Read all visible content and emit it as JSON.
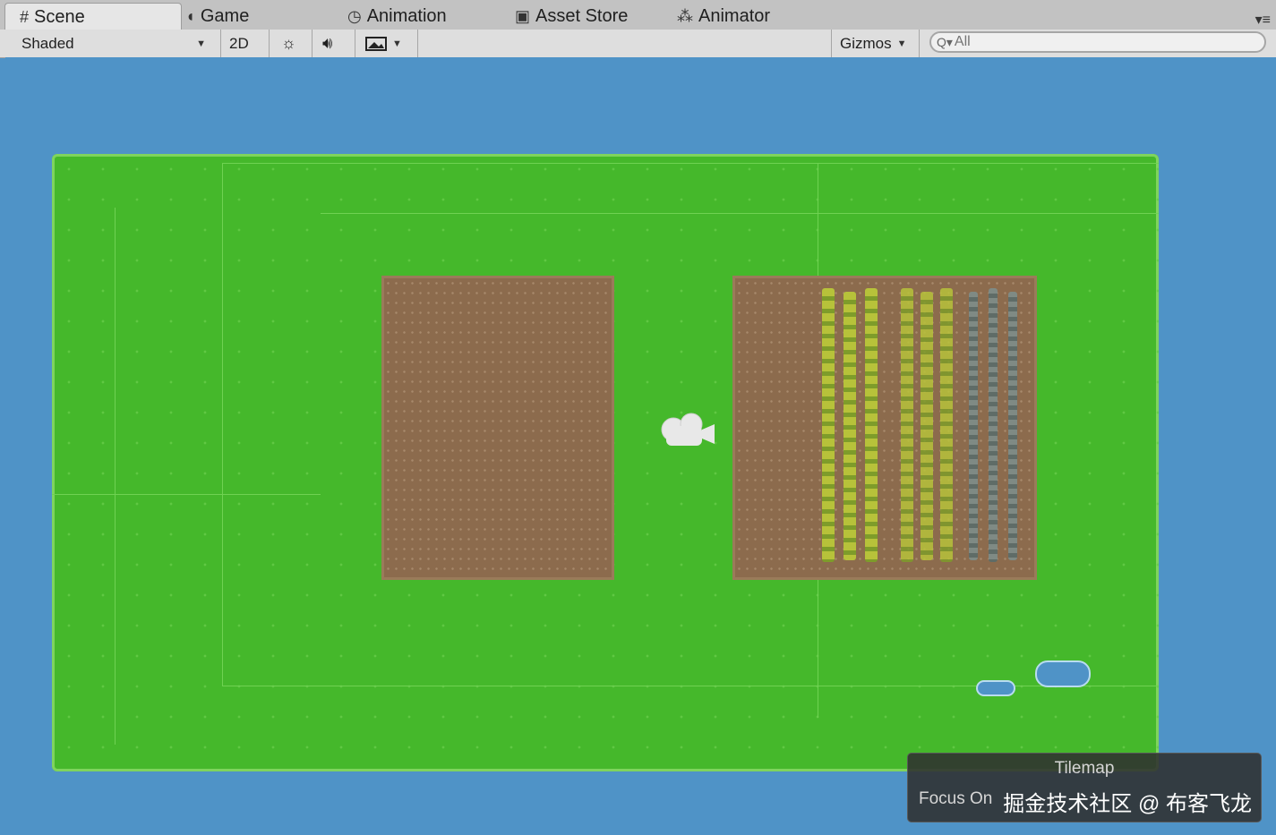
{
  "tabs": [
    {
      "label": "Scene",
      "icon": "grid-icon",
      "active": true
    },
    {
      "label": "Game",
      "icon": "pacman-icon",
      "active": false
    },
    {
      "label": "Animation",
      "icon": "clock-icon",
      "active": false
    },
    {
      "label": "Asset Store",
      "icon": "bag-icon",
      "active": false
    },
    {
      "label": "Animator",
      "icon": "nodes-icon",
      "active": false
    }
  ],
  "toolbar": {
    "shading_mode": "Shaded",
    "mode_2d": "2D",
    "gizmos": "Gizmos",
    "search_placeholder": "All"
  },
  "scene_overlay": {
    "title": "Tilemap",
    "focus_text": "Focus On",
    "watermark": "掘金技术社区 @ 布客飞龙"
  },
  "colors": {
    "sky": "#4f93c7",
    "grass": "#45b82b",
    "soil": "#8c6b4d",
    "crop": "#b7c23a"
  }
}
